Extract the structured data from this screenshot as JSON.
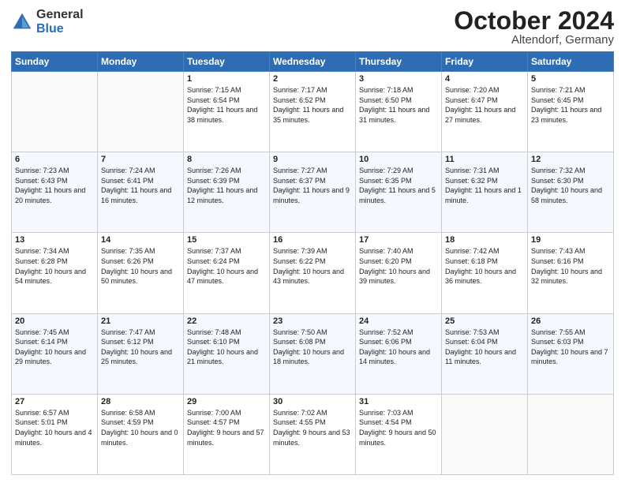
{
  "logo": {
    "general": "General",
    "blue": "Blue"
  },
  "header": {
    "title": "October 2024",
    "subtitle": "Altendorf, Germany"
  },
  "days": [
    "Sunday",
    "Monday",
    "Tuesday",
    "Wednesday",
    "Thursday",
    "Friday",
    "Saturday"
  ],
  "weeks": [
    [
      {
        "day": "",
        "info": ""
      },
      {
        "day": "",
        "info": ""
      },
      {
        "day": "1",
        "info": "Sunrise: 7:15 AM\nSunset: 6:54 PM\nDaylight: 11 hours\nand 38 minutes."
      },
      {
        "day": "2",
        "info": "Sunrise: 7:17 AM\nSunset: 6:52 PM\nDaylight: 11 hours\nand 35 minutes."
      },
      {
        "day": "3",
        "info": "Sunrise: 7:18 AM\nSunset: 6:50 PM\nDaylight: 11 hours\nand 31 minutes."
      },
      {
        "day": "4",
        "info": "Sunrise: 7:20 AM\nSunset: 6:47 PM\nDaylight: 11 hours\nand 27 minutes."
      },
      {
        "day": "5",
        "info": "Sunrise: 7:21 AM\nSunset: 6:45 PM\nDaylight: 11 hours\nand 23 minutes."
      }
    ],
    [
      {
        "day": "6",
        "info": "Sunrise: 7:23 AM\nSunset: 6:43 PM\nDaylight: 11 hours\nand 20 minutes."
      },
      {
        "day": "7",
        "info": "Sunrise: 7:24 AM\nSunset: 6:41 PM\nDaylight: 11 hours\nand 16 minutes."
      },
      {
        "day": "8",
        "info": "Sunrise: 7:26 AM\nSunset: 6:39 PM\nDaylight: 11 hours\nand 12 minutes."
      },
      {
        "day": "9",
        "info": "Sunrise: 7:27 AM\nSunset: 6:37 PM\nDaylight: 11 hours\nand 9 minutes."
      },
      {
        "day": "10",
        "info": "Sunrise: 7:29 AM\nSunset: 6:35 PM\nDaylight: 11 hours\nand 5 minutes."
      },
      {
        "day": "11",
        "info": "Sunrise: 7:31 AM\nSunset: 6:32 PM\nDaylight: 11 hours\nand 1 minute."
      },
      {
        "day": "12",
        "info": "Sunrise: 7:32 AM\nSunset: 6:30 PM\nDaylight: 10 hours\nand 58 minutes."
      }
    ],
    [
      {
        "day": "13",
        "info": "Sunrise: 7:34 AM\nSunset: 6:28 PM\nDaylight: 10 hours\nand 54 minutes."
      },
      {
        "day": "14",
        "info": "Sunrise: 7:35 AM\nSunset: 6:26 PM\nDaylight: 10 hours\nand 50 minutes."
      },
      {
        "day": "15",
        "info": "Sunrise: 7:37 AM\nSunset: 6:24 PM\nDaylight: 10 hours\nand 47 minutes."
      },
      {
        "day": "16",
        "info": "Sunrise: 7:39 AM\nSunset: 6:22 PM\nDaylight: 10 hours\nand 43 minutes."
      },
      {
        "day": "17",
        "info": "Sunrise: 7:40 AM\nSunset: 6:20 PM\nDaylight: 10 hours\nand 39 minutes."
      },
      {
        "day": "18",
        "info": "Sunrise: 7:42 AM\nSunset: 6:18 PM\nDaylight: 10 hours\nand 36 minutes."
      },
      {
        "day": "19",
        "info": "Sunrise: 7:43 AM\nSunset: 6:16 PM\nDaylight: 10 hours\nand 32 minutes."
      }
    ],
    [
      {
        "day": "20",
        "info": "Sunrise: 7:45 AM\nSunset: 6:14 PM\nDaylight: 10 hours\nand 29 minutes."
      },
      {
        "day": "21",
        "info": "Sunrise: 7:47 AM\nSunset: 6:12 PM\nDaylight: 10 hours\nand 25 minutes."
      },
      {
        "day": "22",
        "info": "Sunrise: 7:48 AM\nSunset: 6:10 PM\nDaylight: 10 hours\nand 21 minutes."
      },
      {
        "day": "23",
        "info": "Sunrise: 7:50 AM\nSunset: 6:08 PM\nDaylight: 10 hours\nand 18 minutes."
      },
      {
        "day": "24",
        "info": "Sunrise: 7:52 AM\nSunset: 6:06 PM\nDaylight: 10 hours\nand 14 minutes."
      },
      {
        "day": "25",
        "info": "Sunrise: 7:53 AM\nSunset: 6:04 PM\nDaylight: 10 hours\nand 11 minutes."
      },
      {
        "day": "26",
        "info": "Sunrise: 7:55 AM\nSunset: 6:03 PM\nDaylight: 10 hours\nand 7 minutes."
      }
    ],
    [
      {
        "day": "27",
        "info": "Sunrise: 6:57 AM\nSunset: 5:01 PM\nDaylight: 10 hours\nand 4 minutes."
      },
      {
        "day": "28",
        "info": "Sunrise: 6:58 AM\nSunset: 4:59 PM\nDaylight: 10 hours\nand 0 minutes."
      },
      {
        "day": "29",
        "info": "Sunrise: 7:00 AM\nSunset: 4:57 PM\nDaylight: 9 hours\nand 57 minutes."
      },
      {
        "day": "30",
        "info": "Sunrise: 7:02 AM\nSunset: 4:55 PM\nDaylight: 9 hours\nand 53 minutes."
      },
      {
        "day": "31",
        "info": "Sunrise: 7:03 AM\nSunset: 4:54 PM\nDaylight: 9 hours\nand 50 minutes."
      },
      {
        "day": "",
        "info": ""
      },
      {
        "day": "",
        "info": ""
      }
    ]
  ]
}
